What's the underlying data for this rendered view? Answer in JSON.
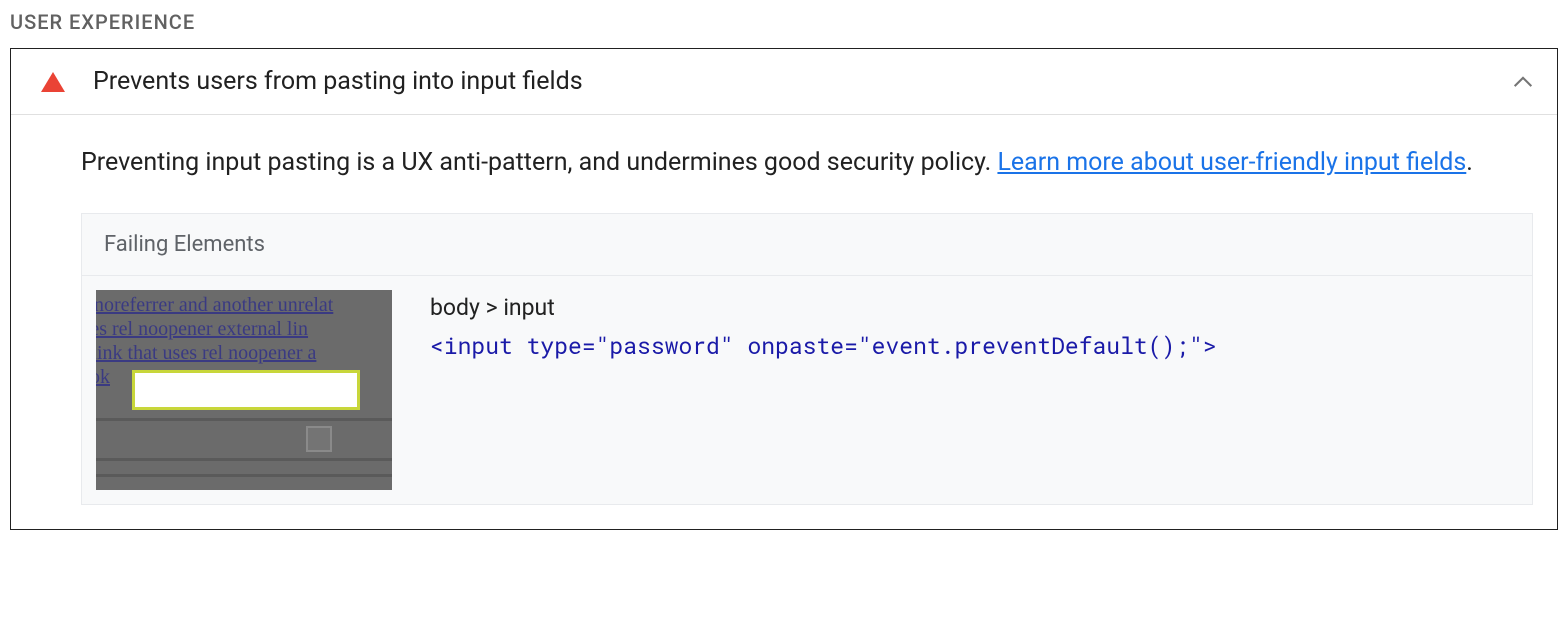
{
  "section": {
    "title": "USER EXPERIENCE"
  },
  "audit": {
    "title": "Prevents users from pasting into input fields",
    "description": "Preventing input pasting is a UX anti-pattern, and undermines good security policy. ",
    "learn_more_text": "Learn more about user-friendly input fields",
    "period": ".",
    "failing_header": "Failing Elements",
    "failing_item": {
      "selector_path": "body > input",
      "code": "<input type=\"password\" onpaste=\"event.preventDefault();\">"
    },
    "thumbnail_text": {
      "line1": "  noreferrer and another unrelat",
      "line2": "t uses rel noopener external lin",
      "line3": "al link that uses rel noopener a",
      "line4": " ok"
    }
  }
}
